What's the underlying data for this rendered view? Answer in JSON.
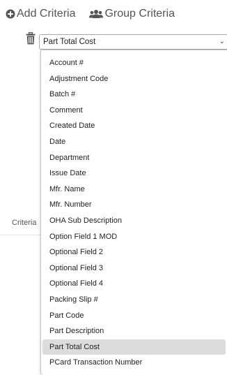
{
  "toolbar": {
    "add_criteria": "Add Criteria",
    "group_criteria": "Group Criteria"
  },
  "criteria_label": "Criteria",
  "select": {
    "value": "Part Total Cost",
    "caret_icon": "chevron-down-icon"
  },
  "dropdown": {
    "selected_index": 18,
    "options": [
      "Account #",
      "Adjustment Code",
      "Batch #",
      "Comment",
      "Created Date",
      "Date",
      "Department",
      "Issue Date",
      "Mfr. Name",
      "Mfr. Number",
      "OHA Sub Description",
      "Option Field 1 MOD",
      "Optional Field 2",
      "Optional Field 3",
      "Optional Field 4",
      "Packing Slip #",
      "Part Code",
      "Part Description",
      "Part Total Cost",
      "PCard Transaction Number"
    ]
  },
  "colors": {
    "selected_bg": "#dcdcdc",
    "icon": "#555555"
  }
}
